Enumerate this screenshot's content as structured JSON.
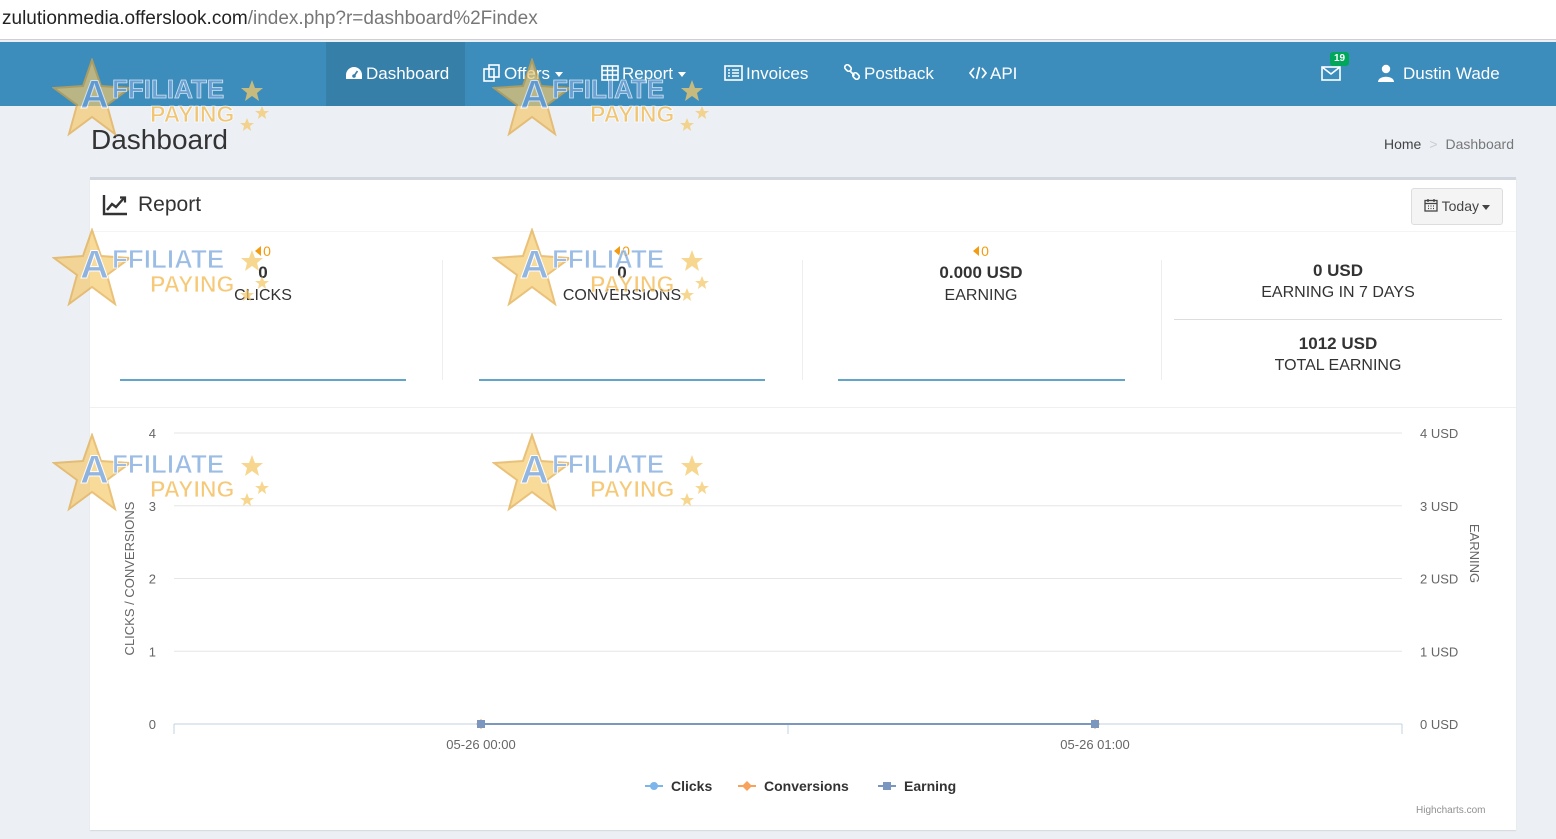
{
  "browser": {
    "url_host": "zulutionmedia.offerslook.com",
    "url_path": "/index.php?r=dashboard%2Findex"
  },
  "nav": {
    "items": [
      {
        "label": "Dashboard",
        "icon": "dashboard-icon",
        "active": true
      },
      {
        "label": "Offers",
        "icon": "offers-icon",
        "dropdown": true
      },
      {
        "label": "Report",
        "icon": "table-icon",
        "dropdown": true
      },
      {
        "label": "Invoices",
        "icon": "list-icon"
      },
      {
        "label": "Postback",
        "icon": "link-icon"
      },
      {
        "label": "API",
        "icon": "code-icon"
      }
    ],
    "mail_count": "19",
    "user_name": "Dustin Wade"
  },
  "watermark": "AFFILIATE PAYING",
  "page": {
    "title": "Dashboard",
    "breadcrumb": [
      "Home",
      "Dashboard"
    ]
  },
  "report": {
    "title": "Report",
    "range_label": "Today",
    "stats": [
      {
        "delta": "0",
        "value": "0",
        "label": "CLICKS"
      },
      {
        "delta": "0",
        "value": "0",
        "label": "CONVERSIONS"
      },
      {
        "delta": "0",
        "value": "0.000 USD",
        "label": "EARNING"
      }
    ],
    "earning_7_days": {
      "value": "0 USD",
      "label": "EARNING IN 7 DAYS"
    },
    "total_earning": {
      "value": "1012 USD",
      "label": "TOTAL EARNING"
    }
  },
  "chart_data": {
    "type": "line",
    "x": [
      "05-26 00:00",
      "05-26 01:00"
    ],
    "series": [
      {
        "name": "Clicks",
        "values": [
          0,
          0
        ],
        "color": "#7cb5ec",
        "marker": "circle",
        "axis": "left"
      },
      {
        "name": "Conversions",
        "values": [
          0,
          0
        ],
        "color": "#f7a35c",
        "marker": "diamond",
        "axis": "left"
      },
      {
        "name": "Earning",
        "values": [
          0,
          0
        ],
        "color": "#7b96bf",
        "marker": "square",
        "axis": "right"
      }
    ],
    "ylabel_left": "CLICKS / CONVERSIONS",
    "ylabel_right": "EARNING",
    "ylim_left": [
      0,
      4
    ],
    "ylim_right": [
      0,
      4
    ],
    "yticks_left": [
      "0",
      "1",
      "2",
      "3",
      "4"
    ],
    "yticks_right": [
      "0 USD",
      "1 USD",
      "2 USD",
      "3 USD",
      "4 USD"
    ],
    "grid": true,
    "legend": "bottom-center",
    "credit": "Highcharts.com"
  }
}
